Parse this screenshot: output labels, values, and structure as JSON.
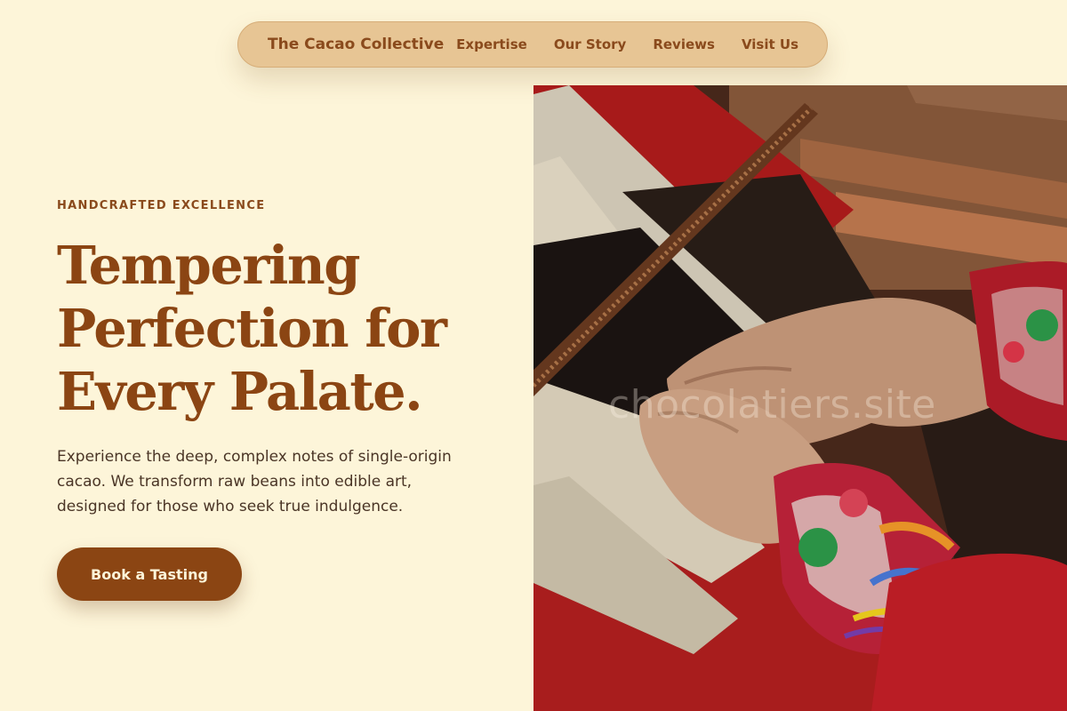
{
  "nav": {
    "brand": "The Cacao Collective",
    "links": [
      {
        "label": "Expertise"
      },
      {
        "label": "Our Story"
      },
      {
        "label": "Reviews"
      },
      {
        "label": "Visit Us"
      }
    ]
  },
  "hero": {
    "eyebrow": "HANDCRAFTED EXCELLENCE",
    "headline_lines": [
      "Tempering",
      "Perfection for",
      "Every Palate."
    ],
    "description": "Experience the deep, complex notes of single-origin cacao. We transform raw beans into edible art, designed for those who seek true indulgence.",
    "cta_label": "Book a Tasting"
  },
  "image": {
    "watermark": "chocolatiers.site"
  },
  "colors": {
    "background": "#fdf5d9",
    "nav_pill": "#e7c594",
    "brand_brown": "#8b4513",
    "body_text": "#4a3526",
    "button_text": "#fdf5d9"
  }
}
